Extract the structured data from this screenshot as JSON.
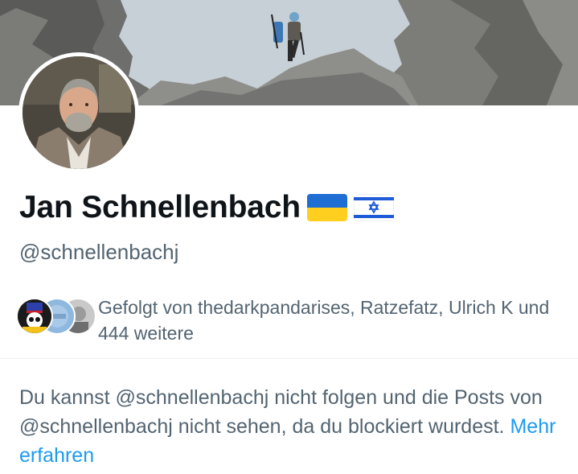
{
  "profile": {
    "display_name": "Jan Schnellenbach",
    "handle": "@schnellenbachj",
    "flags": [
      "ukraine-flag",
      "israel-flag"
    ]
  },
  "followed_by": {
    "text": "Gefolgt von thedarkpandarises, Ratzefatz, Ulrich K und 444 weitere"
  },
  "blocked_notice": {
    "text": "Du kannst @schnellenbachj nicht folgen und die Posts von @schnellenbachj nicht sehen, da du blockiert wurdest.",
    "link_label": "Mehr erfahren"
  },
  "colors": {
    "text_primary": "#0f1419",
    "text_secondary": "#536471",
    "link": "#1d9bf0",
    "divider": "#eff3f4"
  }
}
